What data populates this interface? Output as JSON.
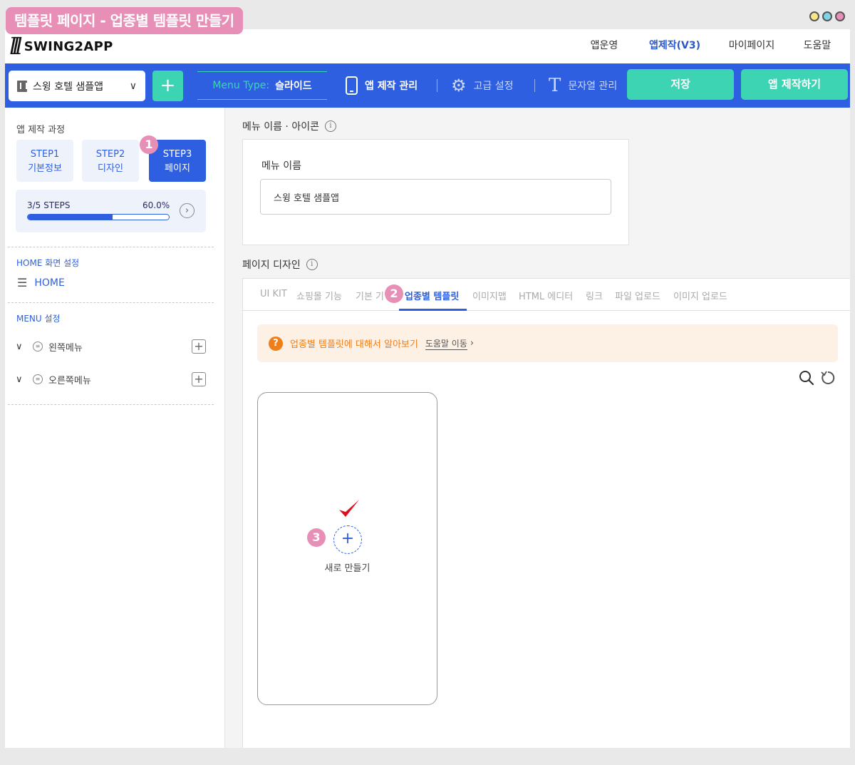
{
  "page_title": "템플릿 페이지 - 업종별 템플릿 만들기",
  "window_dot_colors": [
    "#f7e78a",
    "#7fd3e6",
    "#e88fb7"
  ],
  "brand": {
    "name": "SWING2APP"
  },
  "nav": {
    "items": [
      {
        "label": "앱운영",
        "active": false
      },
      {
        "label": "앱제작(V3)",
        "active": true
      },
      {
        "label": "마이페이지",
        "active": false
      },
      {
        "label": "도움말",
        "active": false
      }
    ]
  },
  "toolbar": {
    "app_select": "스윙 호텔 샘플앱",
    "add_label": "+",
    "menu_type_label": "Menu Type:",
    "menu_type_value": "슬라이드",
    "app_manage": "앱 제작 관리",
    "advanced": "고급 설정",
    "strings": "문자열 관리",
    "save": "저장",
    "make_app": "앱 제작하기"
  },
  "sidebar": {
    "process_title": "앱 제작 과정",
    "steps": [
      {
        "line1": "STEP1",
        "line2": "기본정보",
        "active": false
      },
      {
        "line1": "STEP2",
        "line2": "디자인",
        "active": false
      },
      {
        "line1": "STEP3",
        "line2": "페이지",
        "active": true
      }
    ],
    "progress": {
      "label": "3/5 STEPS",
      "percent_text": "60.0%",
      "value": 0.6
    },
    "home_section": "HOME 화면 설정",
    "home_item": "HOME",
    "menu_section": "MENU 설정",
    "menus": [
      {
        "label": "왼쪽메뉴"
      },
      {
        "label": "오른쪽메뉴"
      }
    ]
  },
  "content": {
    "menu_name_section": "메뉴 이름 · 아이콘",
    "menu_name_label": "메뉴 이름",
    "menu_name_value": "스윙 호텔 샘플앱",
    "page_design_section": "페이지 디자인",
    "tabs": [
      {
        "label": "UI KIT",
        "active": false
      },
      {
        "label": "쇼핑몰 기능",
        "active": false
      },
      {
        "label": "기본 기",
        "active": false
      },
      {
        "label": "업종별 템플릿",
        "active": true
      },
      {
        "label": "이미지맵",
        "active": false
      },
      {
        "label": "HTML 에디터",
        "active": false
      },
      {
        "label": "링크",
        "active": false
      },
      {
        "label": "파일 업로드",
        "active": false
      },
      {
        "label": "이미지 업로드",
        "active": false
      }
    ],
    "notice_text": "업종별 템플릿에 대해서 알아보기",
    "notice_link": "도움말 이동",
    "new_label": "새로 만들기"
  },
  "markers": [
    "1",
    "2",
    "3"
  ],
  "colors": {
    "primary": "#2d5fe0",
    "accent": "#3dd4b4",
    "notice": "#f07e1a",
    "marker": "#e88fb7",
    "check": "#e01020"
  }
}
